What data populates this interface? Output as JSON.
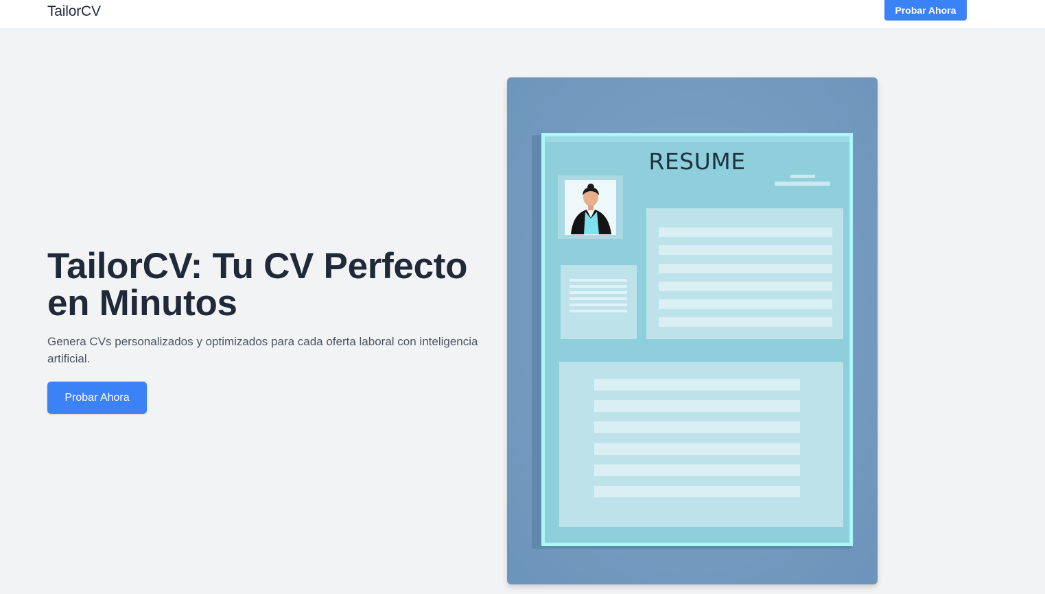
{
  "header": {
    "brand": "TailorCV",
    "cta_label": "Probar Ahora"
  },
  "hero": {
    "title": "TailorCV: Tu CV Perfecto en Minutos",
    "subtitle": "Genera CVs personalizados y optimizados para cada oferta laboral con inteligencia artificial.",
    "cta_label": "Probar Ahora"
  },
  "illustration": {
    "heading": "RESUME"
  },
  "colors": {
    "accent": "#3b82f6",
    "background": "#f2f3f5",
    "illustration_bg": "#7399bd",
    "paper": "#8ecfdb"
  }
}
